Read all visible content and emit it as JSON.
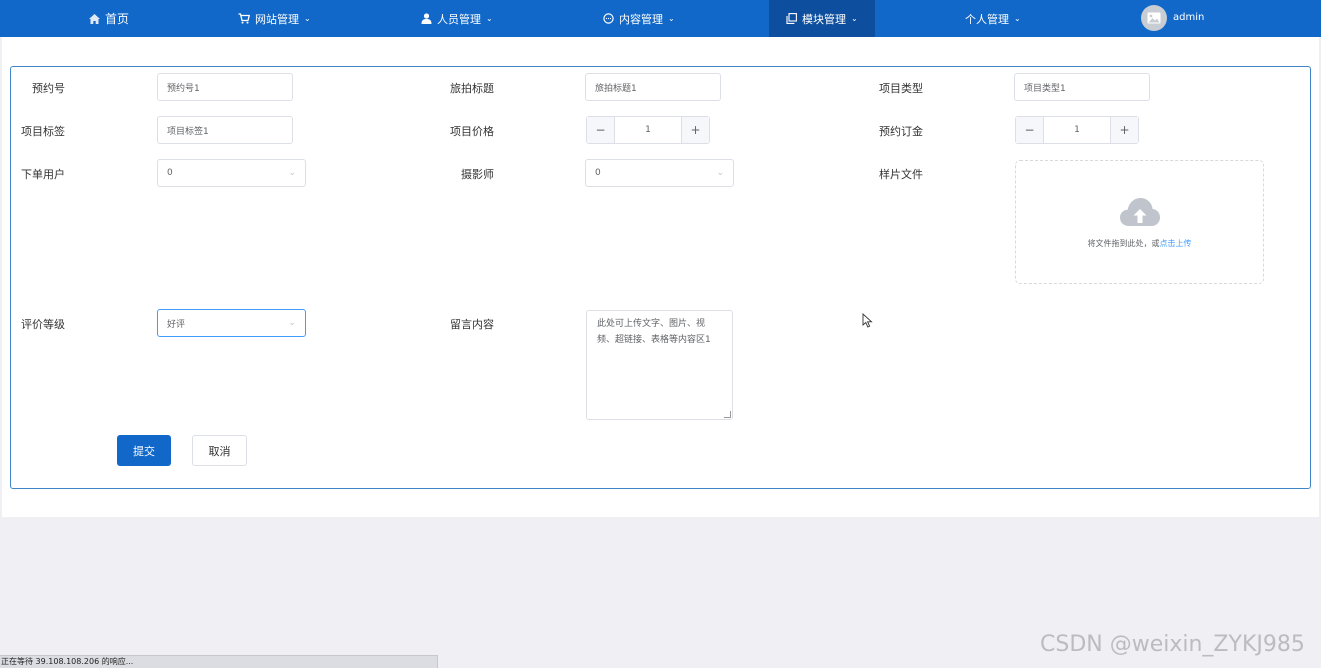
{
  "nav": {
    "home": "首页",
    "website": "网站管理",
    "personnel": "人员管理",
    "content": "内容管理",
    "module": "模块管理",
    "personal": "个人管理",
    "user": "admin"
  },
  "form": {
    "booking_no": {
      "label": "预约号",
      "value": "预约号1"
    },
    "travel_title": {
      "label": "旅拍标题",
      "value": "旅拍标题1"
    },
    "project_type": {
      "label": "项目类型",
      "value": "项目类型1"
    },
    "project_tag": {
      "label": "项目标签",
      "value": "项目标签1"
    },
    "project_price": {
      "label": "项目价格",
      "value": "1"
    },
    "deposit": {
      "label": "预约订金",
      "value": "1"
    },
    "order_user": {
      "label": "下单用户",
      "value": "0"
    },
    "photographer": {
      "label": "摄影师",
      "value": "0"
    },
    "sample_file": {
      "label": "样片文件",
      "hint": "将文件拖到此处，或",
      "link": "点击上传"
    },
    "rating": {
      "label": "评价等级",
      "value": "好评"
    },
    "message": {
      "label": "留言内容",
      "value": "此处可上传文字、图片、视频、超链接、表格等内容区1"
    },
    "submit": "提交",
    "cancel": "取消"
  },
  "statusbar": "正在等待 39.108.108.206 的响应...",
  "watermark": "CSDN @weixin_ZYKJ985",
  "colors": {
    "nav_bg": "#1268c8",
    "nav_active": "#0d4f9e",
    "link": "#409eff"
  }
}
